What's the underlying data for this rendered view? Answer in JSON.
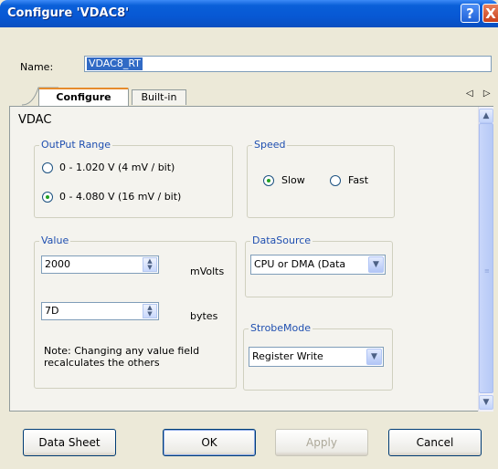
{
  "window": {
    "title": "Configure 'VDAC8'",
    "help_icon": "?",
    "close_icon": "X"
  },
  "name_row": {
    "label": "Name:",
    "value": "VDAC8_RT"
  },
  "tabs": [
    {
      "label": "Configure",
      "active": true
    },
    {
      "label": "Built-in",
      "active": false
    }
  ],
  "tab_scroll": "◁ ▷",
  "section_title": "VDAC",
  "output_range": {
    "legend": "OutPut Range",
    "options": [
      {
        "label": "0 - 1.020 V (4 mV / bit)",
        "selected": false
      },
      {
        "label": "0 - 4.080 V (16 mV / bit)",
        "selected": true
      }
    ]
  },
  "speed": {
    "legend": "Speed",
    "options": [
      {
        "label": "Slow",
        "selected": true
      },
      {
        "label": "Fast",
        "selected": false
      }
    ]
  },
  "value": {
    "legend": "Value",
    "field1_value": "2000",
    "field1_unit": "mVolts",
    "field2_value": "7D",
    "field2_unit": "bytes",
    "note_line1": "Note: Changing any value field",
    "note_line2": "recalculates the others"
  },
  "data_source": {
    "legend": "DataSource",
    "selected": "CPU or DMA (Data"
  },
  "strobe_mode": {
    "legend": "StrobeMode",
    "selected": "Register Write"
  },
  "buttons": {
    "data_sheet": "Data Sheet",
    "ok": "OK",
    "apply": "Apply",
    "cancel": "Cancel"
  },
  "colors": {
    "title_bar": "#0a5fd8",
    "group_label": "#1f4fb0",
    "selection": "#316ac5"
  }
}
